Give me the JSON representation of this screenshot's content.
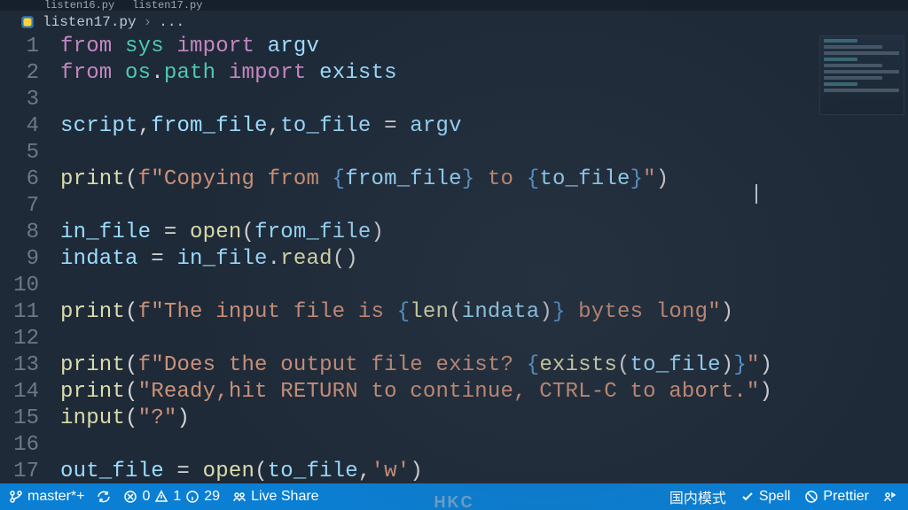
{
  "tabs": [
    {
      "label": "listen16.py"
    },
    {
      "label": "listen17.py"
    }
  ],
  "breadcrumb": {
    "file": "listen17.py",
    "sep": "›",
    "rest": "..."
  },
  "code_lines": [
    {
      "n": "1",
      "tokens": [
        {
          "t": "from ",
          "c": "kw"
        },
        {
          "t": "sys",
          "c": "mod"
        },
        {
          "t": " import ",
          "c": "kw"
        },
        {
          "t": "argv",
          "c": "var"
        }
      ]
    },
    {
      "n": "2",
      "tokens": [
        {
          "t": "from ",
          "c": "kw"
        },
        {
          "t": "os",
          "c": "mod"
        },
        {
          "t": ".",
          "c": "pun"
        },
        {
          "t": "path",
          "c": "mod"
        },
        {
          "t": " import ",
          "c": "kw"
        },
        {
          "t": "exists",
          "c": "var"
        }
      ]
    },
    {
      "n": "3",
      "tokens": []
    },
    {
      "n": "4",
      "tokens": [
        {
          "t": "script",
          "c": "var"
        },
        {
          "t": ",",
          "c": "pun"
        },
        {
          "t": "from_file",
          "c": "var"
        },
        {
          "t": ",",
          "c": "pun"
        },
        {
          "t": "to_file",
          "c": "var"
        },
        {
          "t": " = ",
          "c": "op"
        },
        {
          "t": "argv",
          "c": "var"
        }
      ]
    },
    {
      "n": "5",
      "tokens": []
    },
    {
      "n": "6",
      "tokens": [
        {
          "t": "print",
          "c": "fn"
        },
        {
          "t": "(",
          "c": "pun"
        },
        {
          "t": "f",
          "c": "str"
        },
        {
          "t": "\"Copying from ",
          "c": "str"
        },
        {
          "t": "{",
          "c": "fbrace"
        },
        {
          "t": "from_file",
          "c": "var"
        },
        {
          "t": "}",
          "c": "fbrace"
        },
        {
          "t": " to ",
          "c": "str"
        },
        {
          "t": "{",
          "c": "fbrace"
        },
        {
          "t": "to_file",
          "c": "var"
        },
        {
          "t": "}",
          "c": "fbrace"
        },
        {
          "t": "\"",
          "c": "str"
        },
        {
          "t": ")",
          "c": "pun"
        }
      ]
    },
    {
      "n": "7",
      "tokens": []
    },
    {
      "n": "8",
      "tokens": [
        {
          "t": "in_file",
          "c": "var"
        },
        {
          "t": " = ",
          "c": "op"
        },
        {
          "t": "open",
          "c": "fn"
        },
        {
          "t": "(",
          "c": "pun"
        },
        {
          "t": "from_file",
          "c": "var"
        },
        {
          "t": ")",
          "c": "pun"
        }
      ]
    },
    {
      "n": "9",
      "tokens": [
        {
          "t": "indata",
          "c": "var"
        },
        {
          "t": " = ",
          "c": "op"
        },
        {
          "t": "in_file",
          "c": "var"
        },
        {
          "t": ".",
          "c": "pun"
        },
        {
          "t": "read",
          "c": "fn"
        },
        {
          "t": "()",
          "c": "pun"
        }
      ]
    },
    {
      "n": "10",
      "tokens": []
    },
    {
      "n": "11",
      "tokens": [
        {
          "t": "print",
          "c": "fn"
        },
        {
          "t": "(",
          "c": "pun"
        },
        {
          "t": "f",
          "c": "str"
        },
        {
          "t": "\"The input file is ",
          "c": "str"
        },
        {
          "t": "{",
          "c": "fbrace"
        },
        {
          "t": "len",
          "c": "fn"
        },
        {
          "t": "(",
          "c": "pun"
        },
        {
          "t": "indata",
          "c": "var"
        },
        {
          "t": ")",
          "c": "pun"
        },
        {
          "t": "}",
          "c": "fbrace"
        },
        {
          "t": " bytes long\"",
          "c": "str"
        },
        {
          "t": ")",
          "c": "pun"
        }
      ]
    },
    {
      "n": "12",
      "tokens": []
    },
    {
      "n": "13",
      "tokens": [
        {
          "t": "print",
          "c": "fn"
        },
        {
          "t": "(",
          "c": "pun"
        },
        {
          "t": "f",
          "c": "str"
        },
        {
          "t": "\"Does the output file exist? ",
          "c": "str"
        },
        {
          "t": "{",
          "c": "fbrace"
        },
        {
          "t": "exists",
          "c": "fn"
        },
        {
          "t": "(",
          "c": "pun"
        },
        {
          "t": "to_file",
          "c": "var"
        },
        {
          "t": ")",
          "c": "pun"
        },
        {
          "t": "}",
          "c": "fbrace"
        },
        {
          "t": "\"",
          "c": "str"
        },
        {
          "t": ")",
          "c": "pun"
        }
      ]
    },
    {
      "n": "14",
      "tokens": [
        {
          "t": "print",
          "c": "fn"
        },
        {
          "t": "(",
          "c": "pun"
        },
        {
          "t": "\"Ready,hit RETURN to continue, CTRL-C to abort.\"",
          "c": "str"
        },
        {
          "t": ")",
          "c": "pun"
        }
      ]
    },
    {
      "n": "15",
      "tokens": [
        {
          "t": "input",
          "c": "fn"
        },
        {
          "t": "(",
          "c": "pun"
        },
        {
          "t": "\"?\"",
          "c": "str"
        },
        {
          "t": ")",
          "c": "pun"
        }
      ]
    },
    {
      "n": "16",
      "tokens": []
    },
    {
      "n": "17",
      "tokens": [
        {
          "t": "out_file",
          "c": "var"
        },
        {
          "t": " = ",
          "c": "op"
        },
        {
          "t": "open",
          "c": "fn"
        },
        {
          "t": "(",
          "c": "pun"
        },
        {
          "t": "to_file",
          "c": "var"
        },
        {
          "t": ",",
          "c": "pun"
        },
        {
          "t": "'w'",
          "c": "str"
        },
        {
          "t": ")",
          "c": "pun"
        }
      ]
    }
  ],
  "statusbar": {
    "branch": "master*+",
    "errors": "0",
    "warnings": "1",
    "info": "29",
    "liveshare": "Live Share",
    "mode": "国内模式",
    "spell": "Spell",
    "prettier": "Prettier"
  },
  "monitor": "HKC"
}
